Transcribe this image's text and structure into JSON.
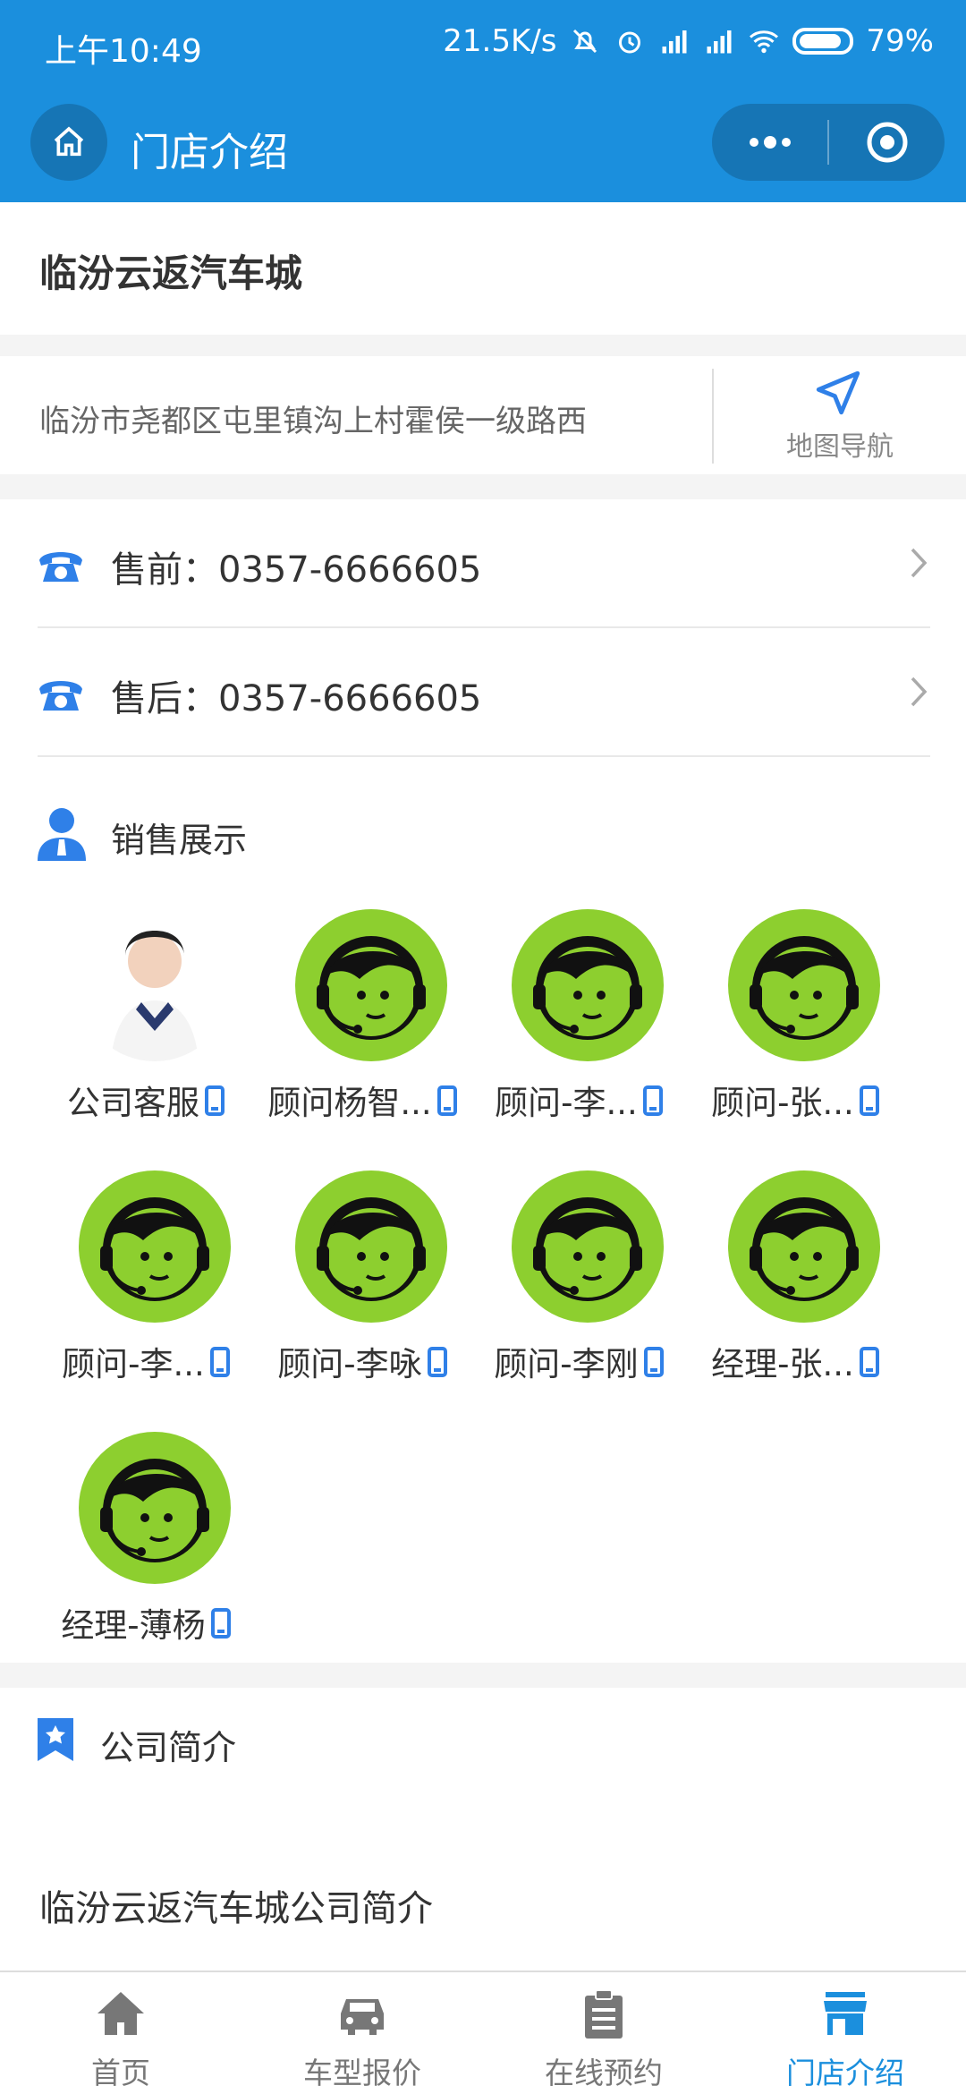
{
  "status_bar": {
    "time": "上午10:49",
    "speed": "21.5K/s",
    "battery": "79%"
  },
  "nav": {
    "title": "门店介绍"
  },
  "store": {
    "name": "临汾云返汽车城",
    "address": "临汾市尧都区屯里镇沟上村霍侯一级路西",
    "map_nav_label": "地图导航"
  },
  "contact": {
    "presale": "售前：0357-6666605",
    "aftersale": "售后：0357-6666605",
    "sales_title": "销售展示",
    "people": [
      {
        "name": "公司客服"
      },
      {
        "name": "顾问杨智..."
      },
      {
        "name": "顾问-李..."
      },
      {
        "name": "顾问-张..."
      },
      {
        "name": "顾问-李..."
      },
      {
        "name": "顾问-李咏"
      },
      {
        "name": "顾问-李刚"
      },
      {
        "name": "经理-张..."
      },
      {
        "name": "经理-薄杨"
      }
    ]
  },
  "intro": {
    "title": "公司简介",
    "text": "临汾云返汽车城公司简介"
  },
  "tabbar": {
    "items": [
      {
        "label": "首页"
      },
      {
        "label": "车型报价"
      },
      {
        "label": "在线预约"
      },
      {
        "label": "门店介绍"
      }
    ]
  },
  "colors": {
    "primary": "#1b8fdd",
    "icon_blue": "#2f80e8",
    "avatar_green": "#8dcf2f"
  }
}
